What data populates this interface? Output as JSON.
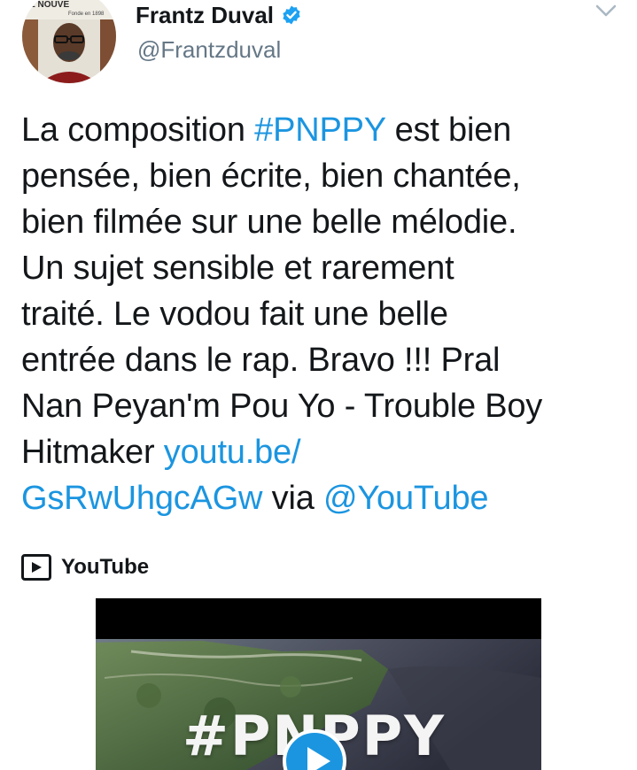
{
  "author": {
    "name": "Frantz Duval",
    "handle": "@Frantzduval",
    "verified": true,
    "avatar_sign_text": "Fonde en 1898",
    "avatar_sign_partial": "LE NOUVE"
  },
  "tweet": {
    "lines": [
      [
        {
          "t": "La composition "
        },
        {
          "t": "#PNPPY",
          "link": true
        },
        {
          "t": " est bien"
        }
      ],
      [
        {
          "t": "pensée, bien écrite, bien chantée,"
        }
      ],
      [
        {
          "t": "bien filmée sur une belle mélodie."
        }
      ],
      [
        {
          "t": "Un sujet sensible et rarement"
        }
      ],
      [
        {
          "t": "traité. Le vodou fait une belle"
        }
      ],
      [
        {
          "t": "entrée dans le rap. Bravo !!! Pral"
        }
      ],
      [
        {
          "t": "Nan Peyan'm Pou Yo - Trouble Boy"
        }
      ],
      [
        {
          "t": "Hitmaker "
        },
        {
          "t": "youtu.be/",
          "link": true
        }
      ],
      [
        {
          "t": "GsRwUhgcAGw",
          "link": true
        },
        {
          "t": " via "
        },
        {
          "t": "@YouTube",
          "link": true
        }
      ]
    ]
  },
  "card": {
    "source_label": "YouTube",
    "source_icon": "youtube-icon",
    "video_title_overlay": "#PNPPY"
  },
  "icons": {
    "menu": "chevron-down-icon",
    "verified": "verified-badge-icon",
    "play": "play-icon"
  },
  "colors": {
    "link": "#1b95e0",
    "text": "#14171a",
    "muted": "#657786",
    "verified": "#1da1f2"
  }
}
